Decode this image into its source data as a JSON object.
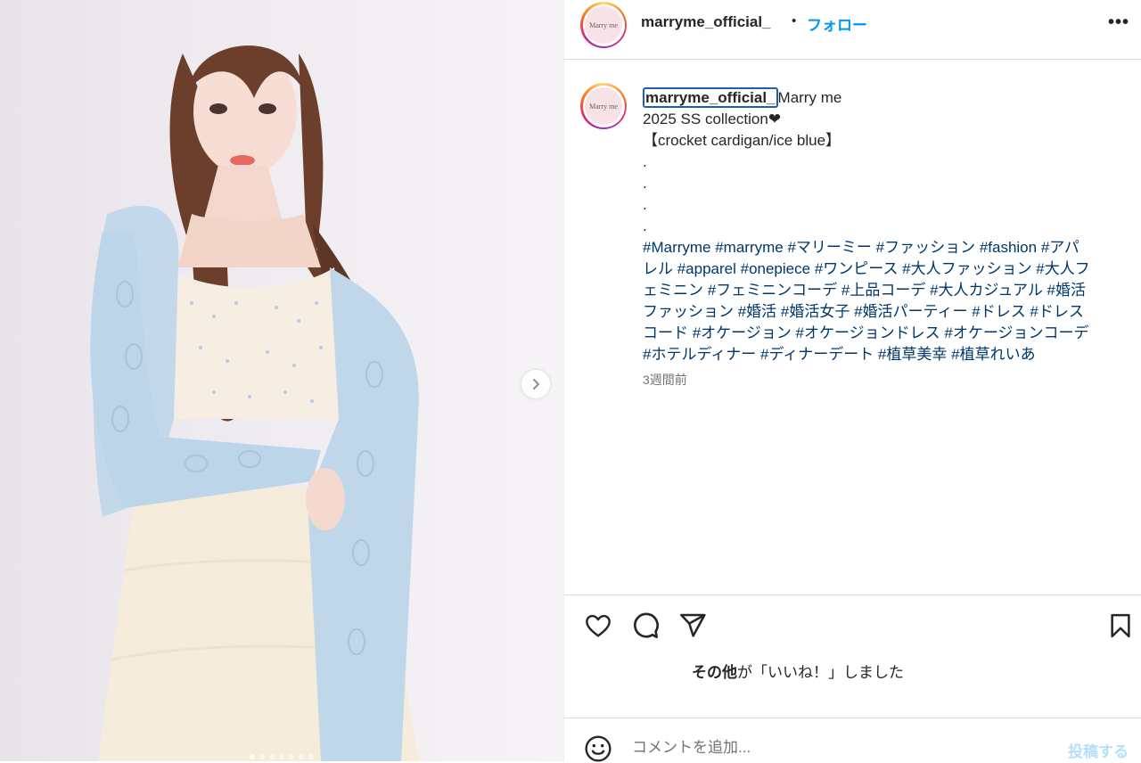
{
  "post": {
    "author": "marryme_official_",
    "separator": "•",
    "follow_label": "フォロー",
    "more_label": "•••",
    "avatar_text": "Marry me",
    "caption_lines": [
      "Marry me",
      "2025 SS collection❤",
      "【crocket cardigan/ice blue】",
      ".",
      ".",
      ".",
      "."
    ],
    "hashtag_lines": [
      "#Marryme #marryme #マリーミー #ファッション #fashion #アパ",
      "レル #apparel #onepiece #ワンピース #大人ファッション #大人フ",
      "ェミニン #フェミニンコーデ #上品コーデ #大人カジュアル #婚活",
      "ファッション #婚活 #婚活女子 #婚活パーティー #ドレス #ドレス",
      "コード #オケージョン #オケージョンドレス #オケージョンコーデ",
      "#ホテルディナー #ディナーデート #植草美幸 #植草れいあ"
    ],
    "time_ago": "3週間前",
    "likes_bold": "その他",
    "likes_rest": "が「いいね！」しました",
    "comment_placeholder": "コメントを追加...",
    "post_button": "投稿する"
  },
  "media": {
    "slide_count": 7,
    "active_slide": 0
  },
  "icons": {
    "like": "heart-icon",
    "comment": "comment-icon",
    "share": "share-icon",
    "save": "bookmark-icon",
    "emoji": "emoji-icon",
    "next": "chevron-right-icon"
  },
  "colors": {
    "link_blue": "#0095f6",
    "hashtag": "#00376b",
    "post_disabled": "#b2dffc"
  }
}
